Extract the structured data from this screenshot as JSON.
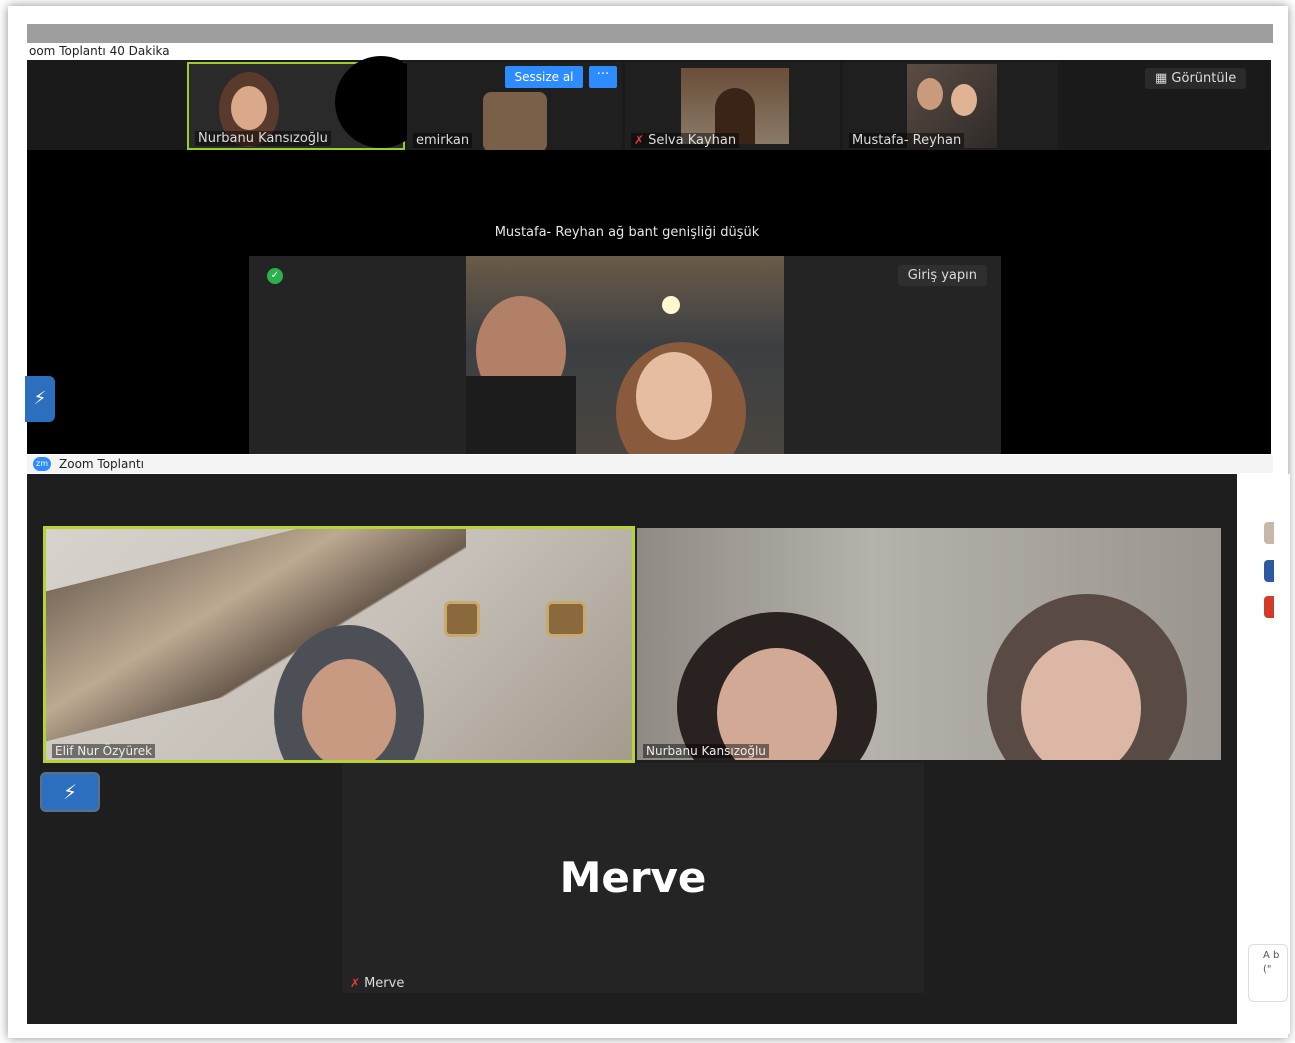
{
  "top_window": {
    "title": "oom Toplantı 40 Dakika",
    "thumbnails": [
      {
        "name": "Nurbanu Kansızoğlu"
      },
      {
        "name": "emirkan"
      },
      {
        "name": "Selva Kayhan"
      },
      {
        "name": "Mustafa- Reyhan"
      }
    ],
    "mute_button": "Sessize al",
    "more_button": "···",
    "view_button": "Görüntüle",
    "bandwidth_message": "Mustafa- Reyhan ağ bant genişliği düşük",
    "signin_button": "Giriş yapın"
  },
  "bottom_window": {
    "title": "Zoom Toplantı",
    "app_icon": "zm",
    "tiles": [
      {
        "name": "Elif Nur Özyürek"
      },
      {
        "name": "Nurbanu Kansızoğlu"
      },
      {
        "name": "Merve",
        "display": "Merve"
      }
    ]
  },
  "right_edge": {
    "text": "A b (\""
  },
  "colors": {
    "zoom_blue": "#2d8cff",
    "active_speaker": "#b5d334",
    "muted_red": "#e23b3b",
    "security_green": "#2bb24c"
  },
  "icons": [
    "shield-icon",
    "mic-muted-icon",
    "grid-icon",
    "zoom-logo-icon",
    "share-screen-icon"
  ]
}
